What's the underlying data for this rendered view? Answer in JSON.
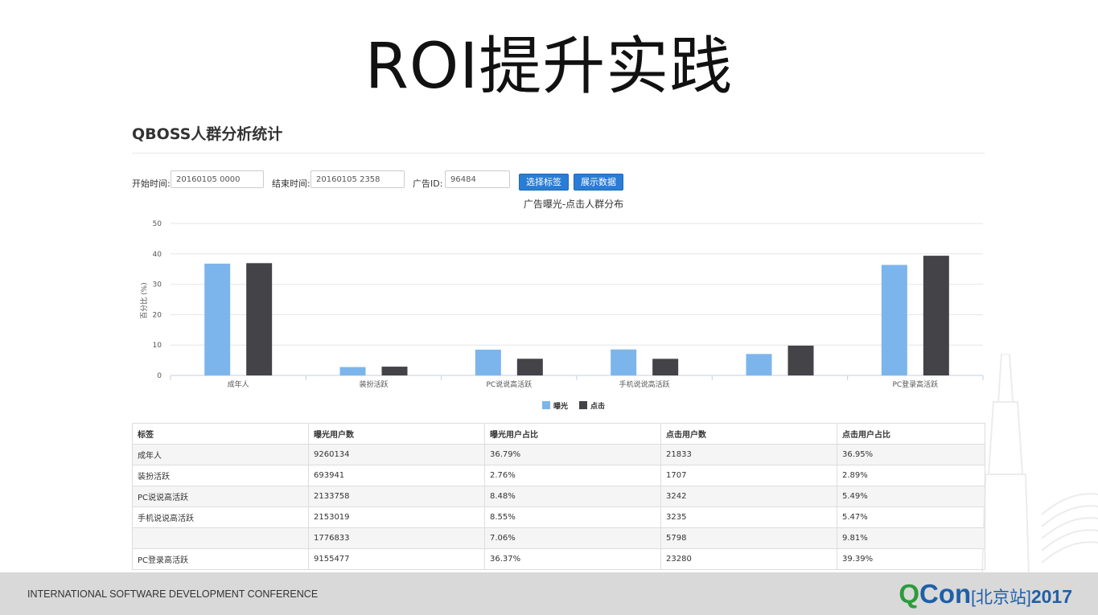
{
  "slide": {
    "title": "ROI提升实践"
  },
  "panel": {
    "title": "QBOSS人群分析统计"
  },
  "form": {
    "start_label": "开始时间:",
    "start_value": "20160105 0000",
    "end_label": "结束时间:",
    "end_value": "20160105 2358",
    "ad_label": "广告ID:",
    "ad_value": "96484",
    "select_tags_button": "选择标签",
    "show_data_button": "展示数据"
  },
  "chart_data": {
    "type": "bar",
    "title": "广告曝光-点击人群分布",
    "ylabel": "百分比 (%)",
    "xlabel": "",
    "ylim": [
      0,
      50
    ],
    "yticks": [
      0,
      10,
      20,
      30,
      40,
      50
    ],
    "grid": true,
    "legend_position": "bottom",
    "categories": [
      "成年人",
      "装扮活跃",
      "PC说说高活跃",
      "手机说说高活跃",
      "",
      "PC登录高活跃"
    ],
    "series": [
      {
        "name": "曝光",
        "color": "#7cb5ec",
        "values": [
          36.79,
          2.76,
          8.48,
          8.55,
          7.06,
          36.37
        ]
      },
      {
        "name": "点击",
        "color": "#434348",
        "values": [
          36.95,
          2.89,
          5.49,
          5.47,
          9.81,
          39.39
        ]
      }
    ]
  },
  "table": {
    "headers": [
      "标签",
      "曝光用户数",
      "曝光用户占比",
      "点击用户数",
      "点击用户占比"
    ],
    "rows": [
      [
        "成年人",
        "9260134",
        "36.79%",
        "21833",
        "36.95%"
      ],
      [
        "装扮活跃",
        "693941",
        "2.76%",
        "1707",
        "2.89%"
      ],
      [
        "PC说说高活跃",
        "2133758",
        "8.48%",
        "3242",
        "5.49%"
      ],
      [
        "手机说说高活跃",
        "2153019",
        "8.55%",
        "3235",
        "5.47%"
      ],
      [
        "",
        "1776833",
        "7.06%",
        "5798",
        "9.81%"
      ],
      [
        "PC登录高活跃",
        "9155477",
        "36.37%",
        "23280",
        "39.39%"
      ]
    ]
  },
  "footer": {
    "conference": "INTERNATIONAL SOFTWARE DEVELOPMENT CONFERENCE",
    "logo_q": "Q",
    "logo_con": "Con",
    "logo_city": "[北京站]",
    "logo_year": "2017"
  }
}
